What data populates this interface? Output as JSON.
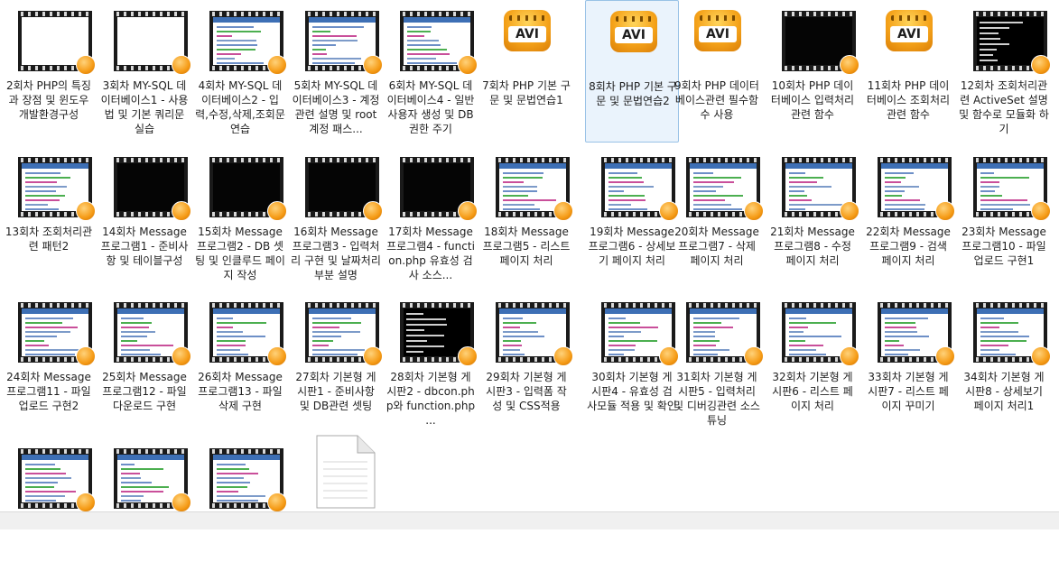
{
  "files": [
    {
      "caption": "2회차 PHP의 특징과 장점 및 윈도우 개발환경구성",
      "thumb": "white"
    },
    {
      "caption": "3회차 MY-SQL 데이터베이스1 - 사용법 및 기본 쿼리문 실습",
      "thumb": "white"
    },
    {
      "caption": "4회차 MY-SQL 데이터베이스2 - 입력,수정,삭제,조회문 연습",
      "thumb": "code"
    },
    {
      "caption": "5회차 MY-SQL 데이터베이스3 - 계정관련 설명 및 root 계정 패스...",
      "thumb": "code"
    },
    {
      "caption": "6회차 MY-SQL 데이터베이스4 - 일반사용자 생성 및 DB권한 주기",
      "thumb": "code"
    },
    {
      "caption": "7회차 PHP 기본 구문 및 문법연습1",
      "thumb": "avi"
    },
    {
      "caption": "8회차 PHP 기본 구문 및 문법연습2",
      "thumb": "avi",
      "selected": true
    },
    {
      "caption": "9회차 PHP 데이터베이스관련 필수함수 사용",
      "thumb": "avi"
    },
    {
      "caption": "10회차 PHP 데이터베이스 입력처리관련 함수",
      "thumb": "black"
    },
    {
      "caption": "11회차 PHP 데이터베이스 조회처리관련 함수",
      "thumb": "avi"
    },
    {
      "caption": "12회차 조회처리관련 ActiveSet 설명 및 함수로 모듈화 하기",
      "thumb": "console"
    },
    {
      "caption": "13회차 조회처리관련 패턴2",
      "thumb": "code"
    },
    {
      "caption": "14회차 Message 프로그램1 - 준비사항 및 테이블구성",
      "thumb": "black"
    },
    {
      "caption": "15회차 Message 프로그램2 - DB 셋팅 및 인클루드 페이지 작성",
      "thumb": "black"
    },
    {
      "caption": "16회차 Message 프로그램3 - 입력처리 구현 및 날짜처리부분 설명",
      "thumb": "black"
    },
    {
      "caption": "17회차 Message 프로그램4 - function.php 유효성 검사 소스...",
      "thumb": "black"
    },
    {
      "caption": "18회차 Message 프로그램5 - 리스트 페이지 처리",
      "thumb": "code"
    },
    {
      "caption": "19회차 Message 프로그램6 - 상세보기 페이지 처리",
      "thumb": "code"
    },
    {
      "caption": "20회차 Message 프로그램7 - 삭제 페이지 처리",
      "thumb": "code"
    },
    {
      "caption": "21회차 Message 프로그램8 - 수정 페이지 처리",
      "thumb": "code"
    },
    {
      "caption": "22회차 Message 프로그램9 - 검색 페이지 처리",
      "thumb": "code"
    },
    {
      "caption": "23회차 Message 프로그램10 - 파일 업로드 구현1",
      "thumb": "code"
    },
    {
      "caption": "24회차 Message 프로그램11 - 파일 업로드 구현2",
      "thumb": "code"
    },
    {
      "caption": "25회차 Message 프로그램12 - 파일 다운로드 구현",
      "thumb": "code"
    },
    {
      "caption": "26회차 Message 프로그램13 - 파일 삭제 구현",
      "thumb": "code"
    },
    {
      "caption": "27회차 기본형 게시판1 - 준비사항 및 DB관련 셋팅",
      "thumb": "code"
    },
    {
      "caption": "28회차 기본형 게시판2 - dbcon.php와 function.php ...",
      "thumb": "console"
    },
    {
      "caption": "29회차 기본형 게시판3 - 입력폼 작성 및 CSS적용",
      "thumb": "code"
    },
    {
      "caption": "30회차 기본형 게시판4 - 유효성 검사모듈 적용 및 확인",
      "thumb": "code"
    },
    {
      "caption": "31회차 기본형 게시판5 - 입력처리 및 디버깅관련 소스튜닝",
      "thumb": "code"
    },
    {
      "caption": "32회차 기본형 게시판6 - 리스트 페이지 처리",
      "thumb": "code"
    },
    {
      "caption": "33회차 기본형 게시판7 - 리스트 페이지 꾸미기",
      "thumb": "code"
    },
    {
      "caption": "34회차 기본형 게시판8 - 상세보기 페이지 처리1",
      "thumb": "code"
    },
    {
      "caption": "",
      "thumb": "code"
    },
    {
      "caption": "",
      "thumb": "code"
    },
    {
      "caption": "",
      "thumb": "code"
    }
  ],
  "generic_file_icon": "document-icon",
  "avi_label": "AVI"
}
